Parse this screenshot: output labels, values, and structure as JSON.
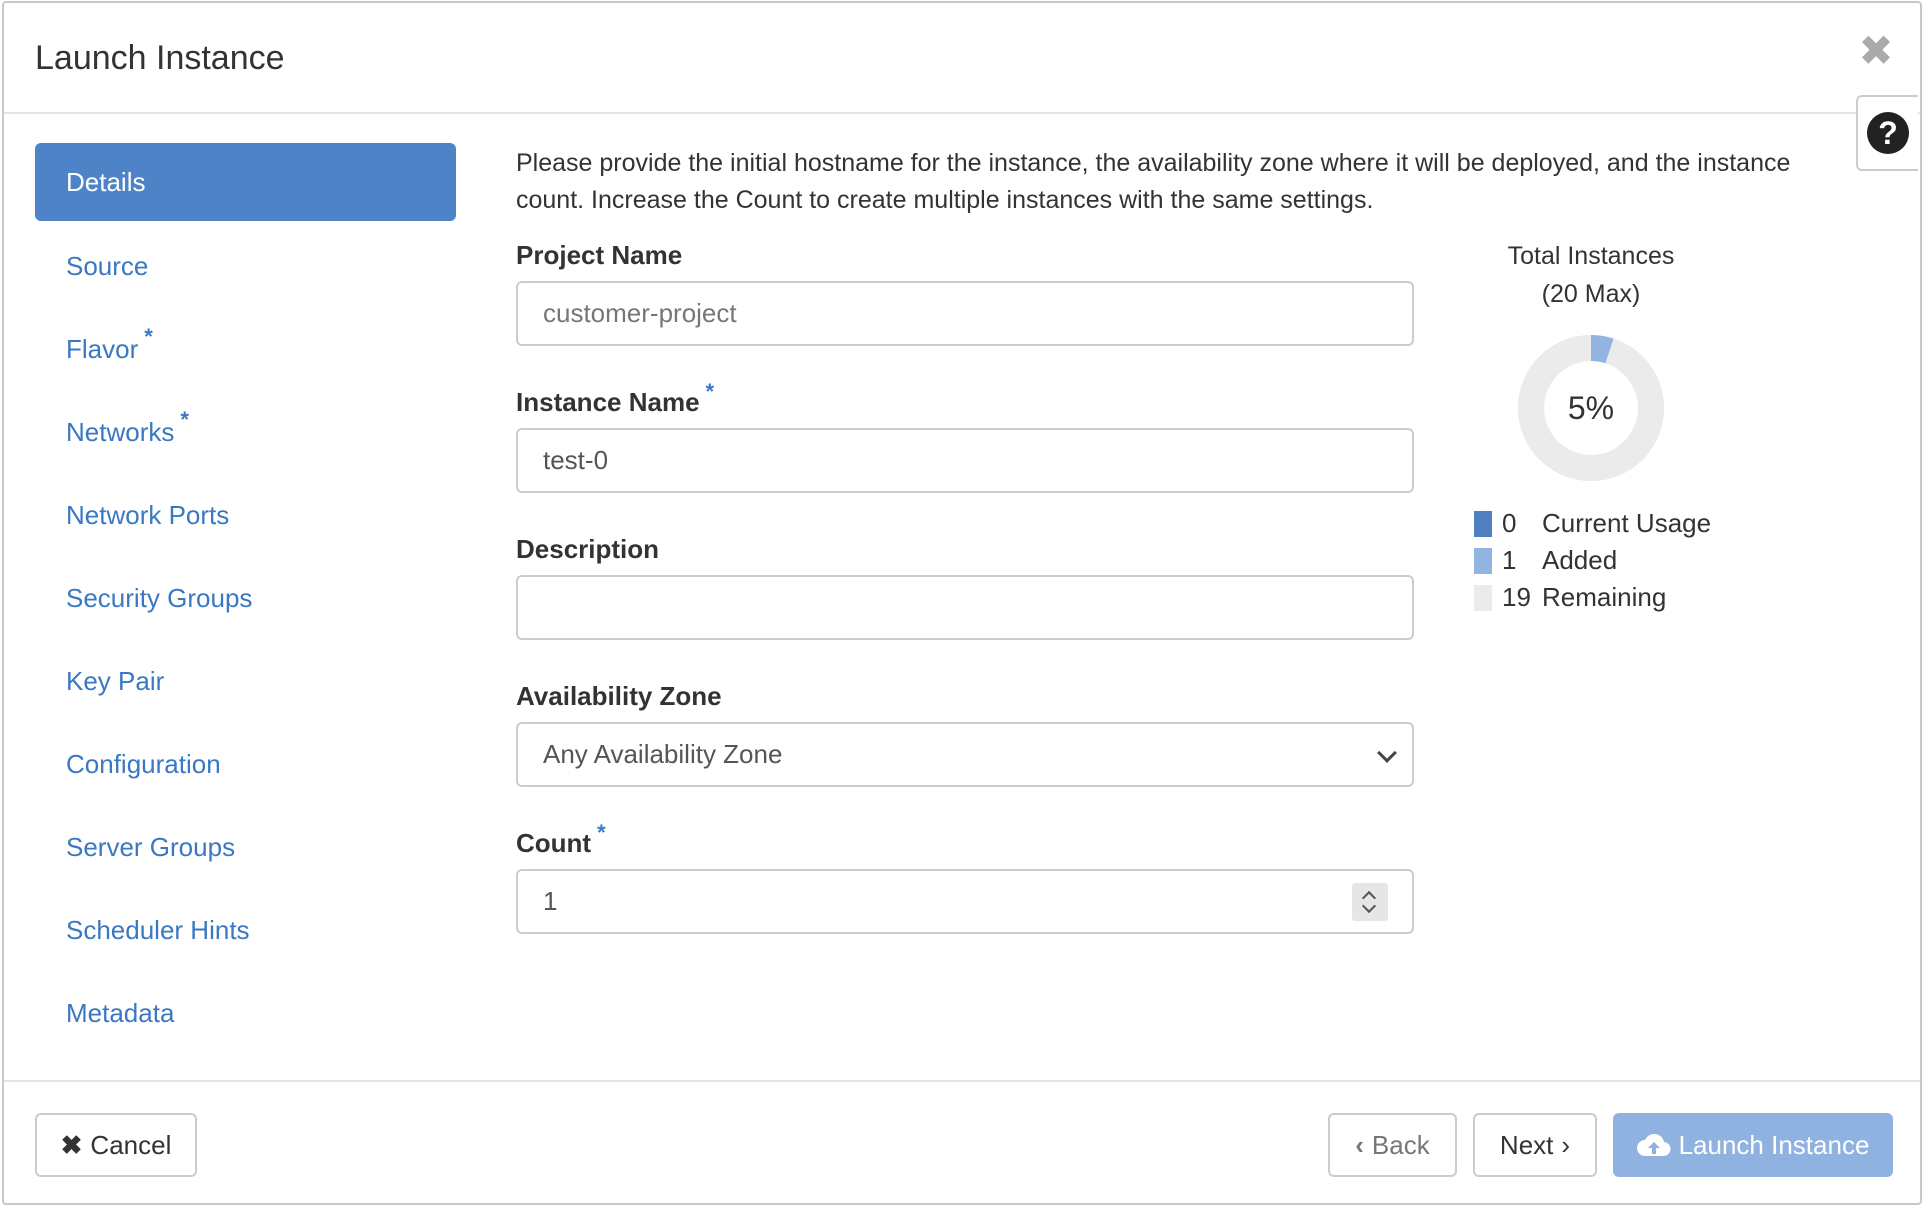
{
  "modal": {
    "title": "Launch Instance",
    "close_icon": "close-icon",
    "help_icon": "question-circle-icon",
    "help_glyph": "?"
  },
  "sidebar": {
    "items": [
      {
        "label": "Details",
        "active": true,
        "required": false
      },
      {
        "label": "Source",
        "active": false,
        "required": false
      },
      {
        "label": "Flavor",
        "active": false,
        "required": true
      },
      {
        "label": "Networks",
        "active": false,
        "required": true
      },
      {
        "label": "Network Ports",
        "active": false,
        "required": false
      },
      {
        "label": "Security Groups",
        "active": false,
        "required": false
      },
      {
        "label": "Key Pair",
        "active": false,
        "required": false
      },
      {
        "label": "Configuration",
        "active": false,
        "required": false
      },
      {
        "label": "Server Groups",
        "active": false,
        "required": false
      },
      {
        "label": "Scheduler Hints",
        "active": false,
        "required": false
      },
      {
        "label": "Metadata",
        "active": false,
        "required": false
      }
    ],
    "required_mark": "*"
  },
  "main": {
    "intro": "Please provide the initial hostname for the instance, the availability zone where it will be deployed, and the instance count. Increase the Count to create multiple instances with the same settings.",
    "fields": {
      "project_name": {
        "label": "Project Name",
        "value": "customer-project"
      },
      "instance_name": {
        "label": "Instance Name",
        "value": "test-0",
        "required_mark": "*"
      },
      "description": {
        "label": "Description",
        "value": ""
      },
      "availability_zone": {
        "label": "Availability Zone",
        "value": "Any Availability Zone"
      },
      "count": {
        "label": "Count",
        "value": "1",
        "required_mark": "*"
      }
    }
  },
  "chart_data": {
    "type": "pie",
    "title": "Total Instances",
    "subtitle": "(20 Max)",
    "center_label": "5%",
    "max": 20,
    "slices": [
      {
        "name": "Current Usage",
        "value": 0,
        "color": "#4f7fc2"
      },
      {
        "name": "Added",
        "value": 1,
        "color": "#92b4e0"
      },
      {
        "name": "Remaining",
        "value": 19,
        "color": "#ebebeb"
      }
    ]
  },
  "footer": {
    "cancel_label": "Cancel",
    "cancel_glyph": "✖",
    "back_label": "Back",
    "back_glyph": "‹",
    "next_label": "Next",
    "next_glyph": "›",
    "launch_label": "Launch Instance",
    "launch_icon": "cloud-upload-icon"
  }
}
